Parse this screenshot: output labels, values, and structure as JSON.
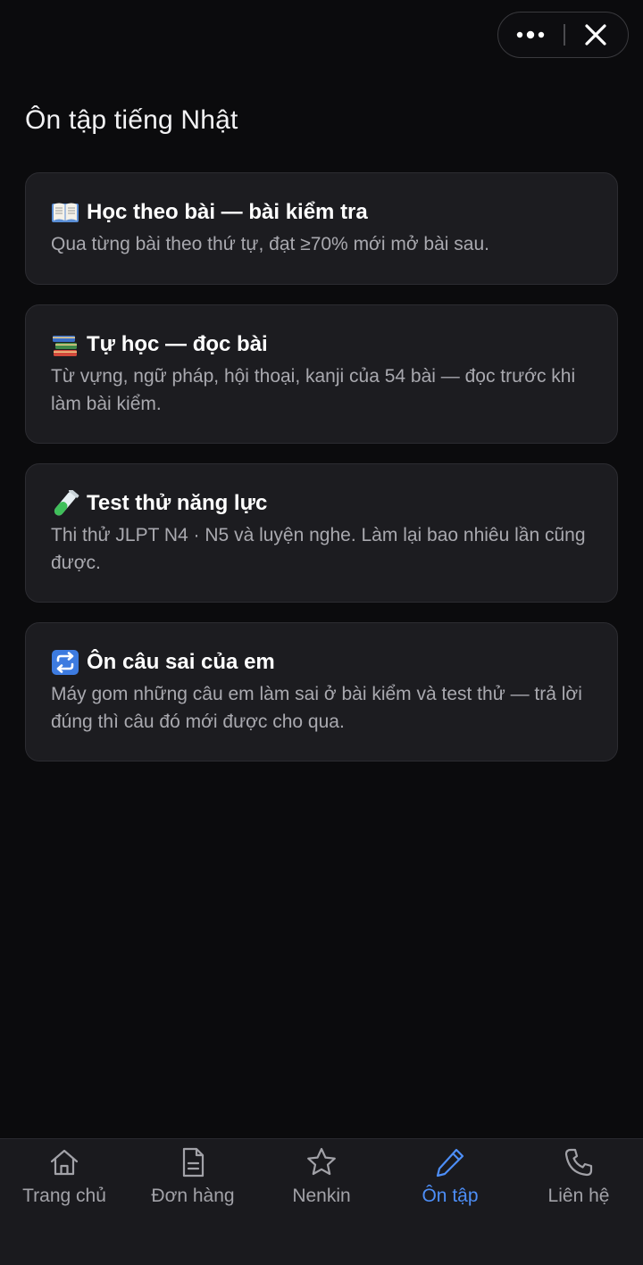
{
  "header": {
    "more_icon": "more-dots-icon",
    "close_icon": "close-icon",
    "page_title": "Ôn tập tiếng Nhật"
  },
  "cards": [
    {
      "icon": "open-book-icon",
      "title": "Học theo bài — bài kiểm tra",
      "description": "Qua từng bài theo thứ tự, đạt ≥70% mới mở bài sau."
    },
    {
      "icon": "books-stack-icon",
      "title": "Tự học — đọc bài",
      "description": "Từ vựng, ngữ pháp, hội thoại, kanji của 54 bài — đọc trước khi làm bài kiểm."
    },
    {
      "icon": "test-tube-icon",
      "title": "Test thử năng lực",
      "description": "Thi thử JLPT N4 · N5 và luyện nghe. Làm lại bao nhiêu lần cũng được."
    },
    {
      "icon": "repeat-icon",
      "title": "Ôn câu sai của em",
      "description": "Máy gom những câu em làm sai ở bài kiểm và test thử — trả lời đúng thì câu đó mới được cho qua."
    }
  ],
  "bottom_nav": {
    "items": [
      {
        "label": "Trang chủ",
        "icon": "home-icon",
        "active": false
      },
      {
        "label": "Đơn hàng",
        "icon": "document-icon",
        "active": false
      },
      {
        "label": "Nenkin",
        "icon": "star-icon",
        "active": false
      },
      {
        "label": "Ôn tập",
        "icon": "pencil-icon",
        "active": true
      },
      {
        "label": "Liên hệ",
        "icon": "phone-icon",
        "active": false
      }
    ]
  },
  "colors": {
    "background": "#0b0b0d",
    "card": "#1c1c20",
    "accent": "#4d8ef7",
    "muted_text": "#a9a9af"
  }
}
